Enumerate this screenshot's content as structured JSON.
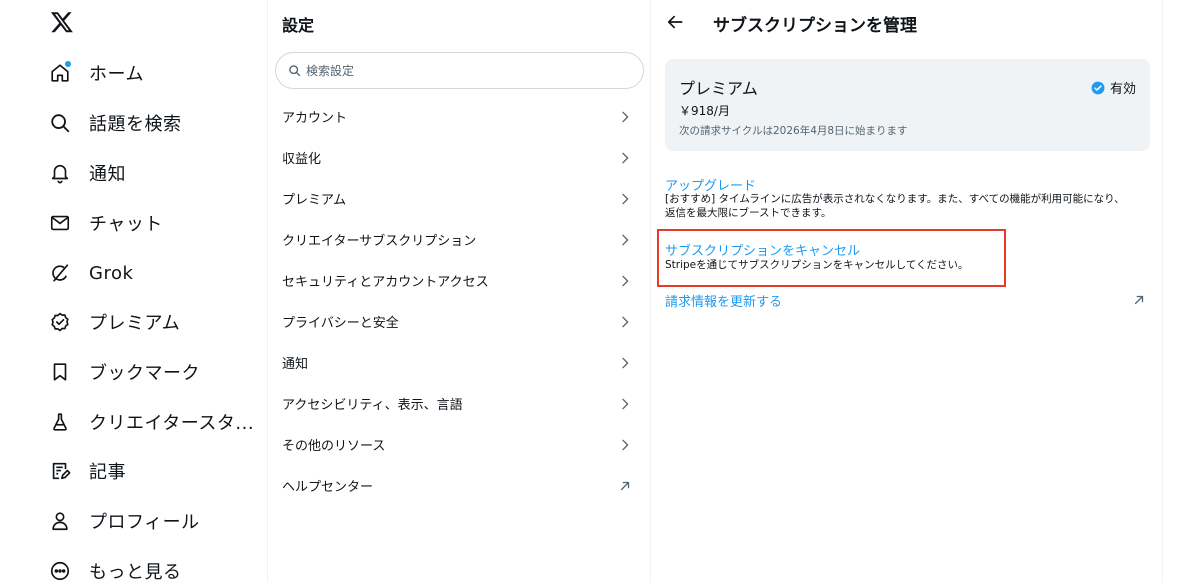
{
  "nav": {
    "items": [
      {
        "label": "ホーム",
        "icon": "home-icon"
      },
      {
        "label": "話題を検索",
        "icon": "search-icon"
      },
      {
        "label": "通知",
        "icon": "bell-icon"
      },
      {
        "label": "チャット",
        "icon": "mail-icon"
      },
      {
        "label": "Grok",
        "icon": "grok-icon"
      },
      {
        "label": "プレミアム",
        "icon": "verified-icon"
      },
      {
        "label": "ブックマーク",
        "icon": "bookmark-icon"
      },
      {
        "label": "クリエイタースタ...",
        "icon": "flask-icon"
      },
      {
        "label": "記事",
        "icon": "article-icon"
      },
      {
        "label": "プロフィール",
        "icon": "user-icon"
      },
      {
        "label": "もっと見る",
        "icon": "more-icon"
      }
    ]
  },
  "settings": {
    "title": "設定",
    "search_placeholder": "検索設定",
    "items": [
      {
        "label": "アカウント"
      },
      {
        "label": "収益化"
      },
      {
        "label": "プレミアム"
      },
      {
        "label": "クリエイターサブスクリプション"
      },
      {
        "label": "セキュリティとアカウントアクセス"
      },
      {
        "label": "プライバシーと安全"
      },
      {
        "label": "通知"
      },
      {
        "label": "アクセシビリティ、表示、言語"
      },
      {
        "label": "その他のリソース"
      },
      {
        "label": "ヘルプセンター"
      }
    ]
  },
  "detail": {
    "title": "サブスクリプションを管理",
    "plan": {
      "name": "プレミアム",
      "price": "￥918/月",
      "billing": "次の請求サイクルは2026年4月8日に始まります",
      "status": "有効"
    },
    "upgrade": {
      "label": "アップグレード",
      "desc": "[おすすめ] タイムラインに広告が表示されなくなります。また、すべての機能が利用可能になり、返信を最大限にブーストできます。"
    },
    "cancel": {
      "label": "サブスクリプションをキャンセル",
      "desc": "Stripeを通じてサブスクリプションをキャンセルしてください。"
    },
    "update_billing": {
      "label": "請求情報を更新する"
    }
  },
  "colors": {
    "accent": "#1d9bf0",
    "highlight": "#e53b26",
    "card_bg": "#f0f3f5"
  }
}
